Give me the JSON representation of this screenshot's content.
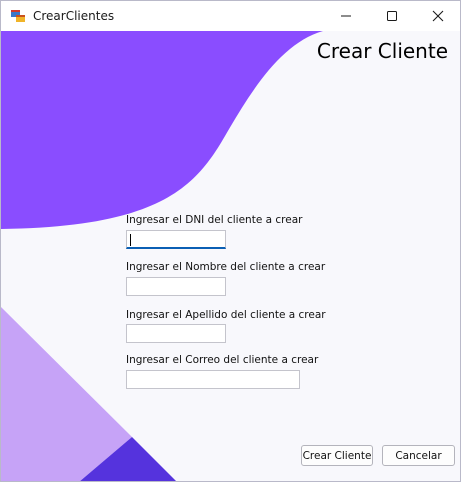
{
  "window": {
    "title": "CrearClientes"
  },
  "form": {
    "heading": "Crear Cliente",
    "dni_label": "Ingresar el DNI del cliente a crear",
    "dni_value": "",
    "nombre_label": "Ingresar el Nombre del cliente a crear",
    "nombre_value": "",
    "apellido_label": "Ingresar el Apellido del cliente a crear",
    "apellido_value": "",
    "correo_label": "Ingresar el Correo del cliente a crear",
    "correo_value": ""
  },
  "buttons": {
    "create_label": "Crear Cliente",
    "cancel_label": "Cancelar"
  },
  "icons": {
    "app": "app-window-icon",
    "minimize": "minimize-icon",
    "maximize": "maximize-icon",
    "close": "close-icon"
  },
  "colors": {
    "accent_purple": "#8a4dff",
    "light_purple": "#c6a3f7",
    "dark_purple": "#5533dd",
    "focus_underline": "#0a5fb4"
  }
}
